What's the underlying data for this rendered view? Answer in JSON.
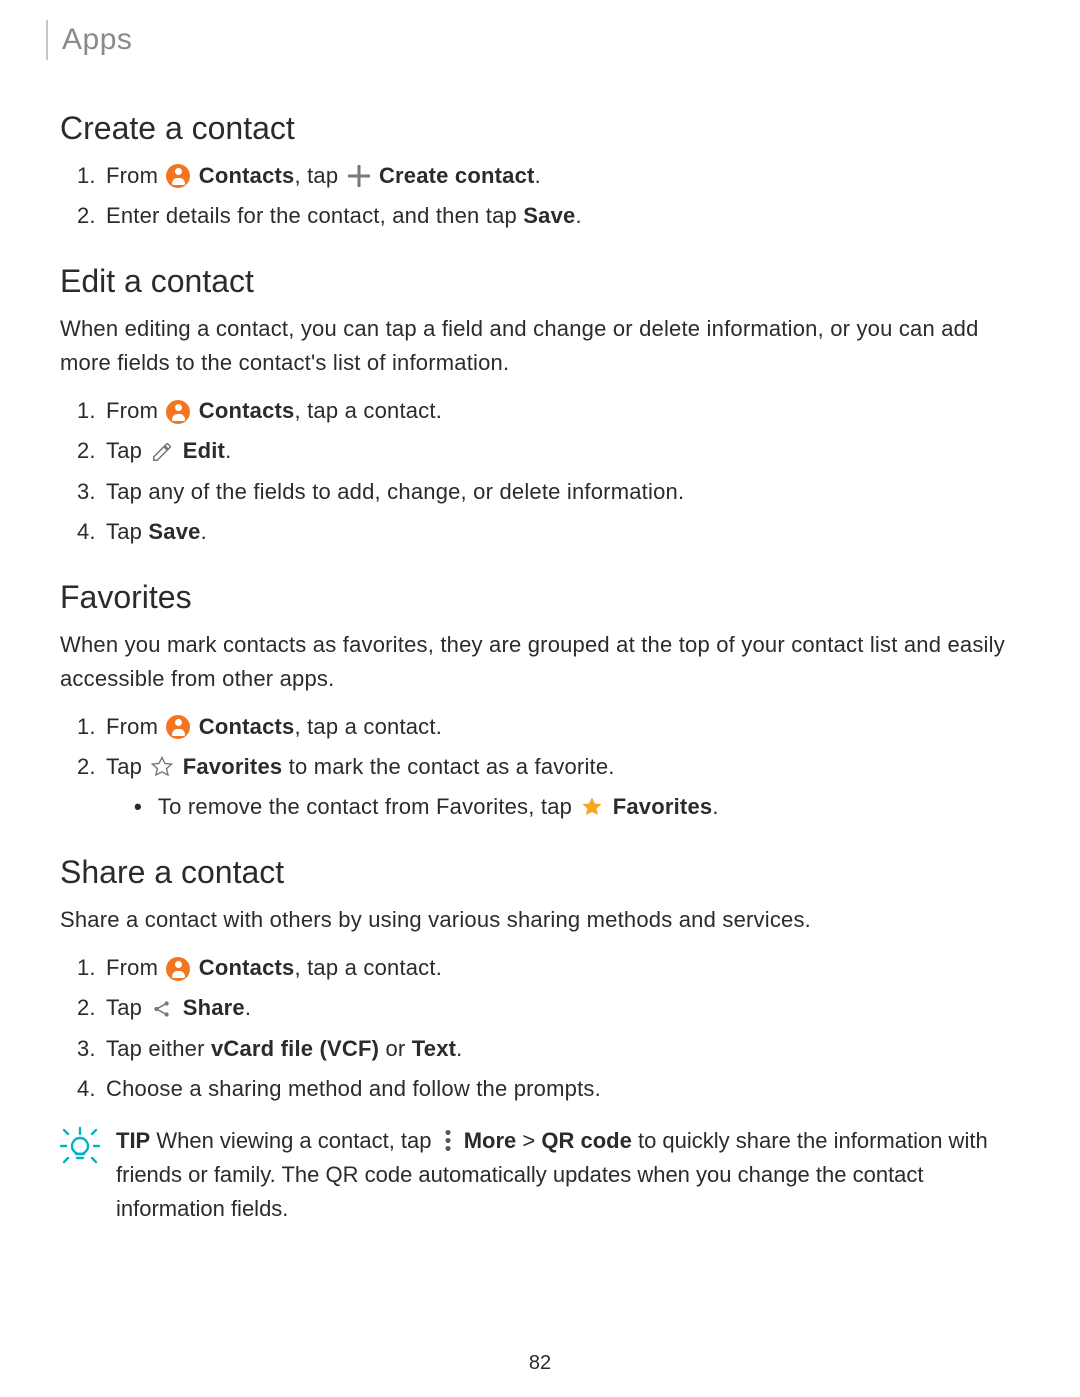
{
  "breadcrumb": "Apps",
  "page_number": "82",
  "create": {
    "heading": "Create a contact",
    "steps": {
      "s1_pre": "From ",
      "s1_contacts": "Contacts",
      "s1_mid": ", tap ",
      "s1_action": "Create contact",
      "s1_end": ".",
      "s2_pre": "Enter details for the contact, and then tap ",
      "s2_bold": "Save",
      "s2_end": "."
    }
  },
  "edit": {
    "heading": "Edit a contact",
    "intro": "When editing a contact, you can tap a field and change or delete information, or you can add more fields to the contact's list of information.",
    "steps": {
      "s1_pre": "From ",
      "s1_contacts": "Contacts",
      "s1_end": ", tap a contact.",
      "s2_pre": "Tap ",
      "s2_bold": "Edit",
      "s2_end": ".",
      "s3": "Tap any of the fields to add, change, or delete information.",
      "s4_pre": "Tap ",
      "s4_bold": "Save",
      "s4_end": "."
    }
  },
  "favorites": {
    "heading": "Favorites",
    "intro": "When you mark contacts as favorites, they are grouped at the top of your contact list and easily accessible from other apps.",
    "steps": {
      "s1_pre": "From ",
      "s1_contacts": "Contacts",
      "s1_end": ", tap a contact.",
      "s2_pre": "Tap ",
      "s2_bold": "Favorites",
      "s2_end": " to mark the contact as a favorite.",
      "sub_pre": "To remove the contact from Favorites, tap ",
      "sub_bold": "Favorites",
      "sub_end": "."
    }
  },
  "share": {
    "heading": "Share a contact",
    "intro": "Share a contact with others by using various sharing methods and services.",
    "steps": {
      "s1_pre": "From ",
      "s1_contacts": "Contacts",
      "s1_end": ", tap a contact.",
      "s2_pre": "Tap ",
      "s2_bold": "Share",
      "s2_end": ".",
      "s3_pre": "Tap either ",
      "s3_b1": "vCard file (VCF)",
      "s3_mid": " or ",
      "s3_b2": "Text",
      "s3_end": ".",
      "s4": "Choose a sharing method and follow the prompts."
    }
  },
  "tip": {
    "label": "TIP",
    "pre": "  When viewing a contact, tap ",
    "more": "More",
    "gt": " > ",
    "qr": "QR code",
    "post": " to quickly share the information with friends or family. The QR code automatically updates when you change the contact information fields."
  },
  "icons": {
    "contacts": "contacts-icon",
    "plus": "plus-icon",
    "edit": "edit-pencil-icon",
    "star_outline": "star-outline-icon",
    "star_fill": "star-filled-icon",
    "share": "share-icon",
    "more": "more-vertical-icon",
    "tip": "tip-lightbulb-icon"
  },
  "colors": {
    "accent_orange": "#f47521",
    "accent_amber": "#f5a623",
    "tip_cyan": "#00b4c5",
    "text": "#2b2b2b",
    "muted": "#8a8a8a"
  }
}
